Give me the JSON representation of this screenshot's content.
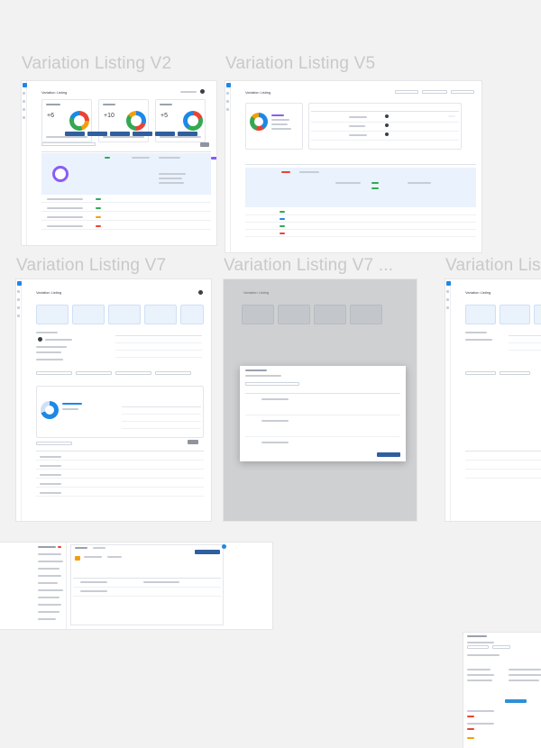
{
  "frames": [
    {
      "title": "Variation Listing V2",
      "page_heading": "Variation Listing"
    },
    {
      "title": "Variation Listing V5",
      "page_heading": "Variation Listing"
    },
    {
      "title": "Variation Listing V7",
      "page_heading": "Variation Listing"
    },
    {
      "title": "Variation Listing V7 ...",
      "page_heading": "Variation Listing"
    },
    {
      "title": "Variation Lis",
      "page_heading": "Variation Listing"
    }
  ],
  "v2": {
    "stat_values": [
      "+6",
      "+10",
      "+5"
    ]
  },
  "colors": {
    "canvas": "#f2f2f2",
    "frame_title": "#c9c9c9",
    "primary": "#2f5f9e",
    "accent_blue": "#1e88e5",
    "purple": "#8b5cf6",
    "green": "#34a853",
    "orange": "#f59e0b",
    "red": "#ea4335"
  }
}
